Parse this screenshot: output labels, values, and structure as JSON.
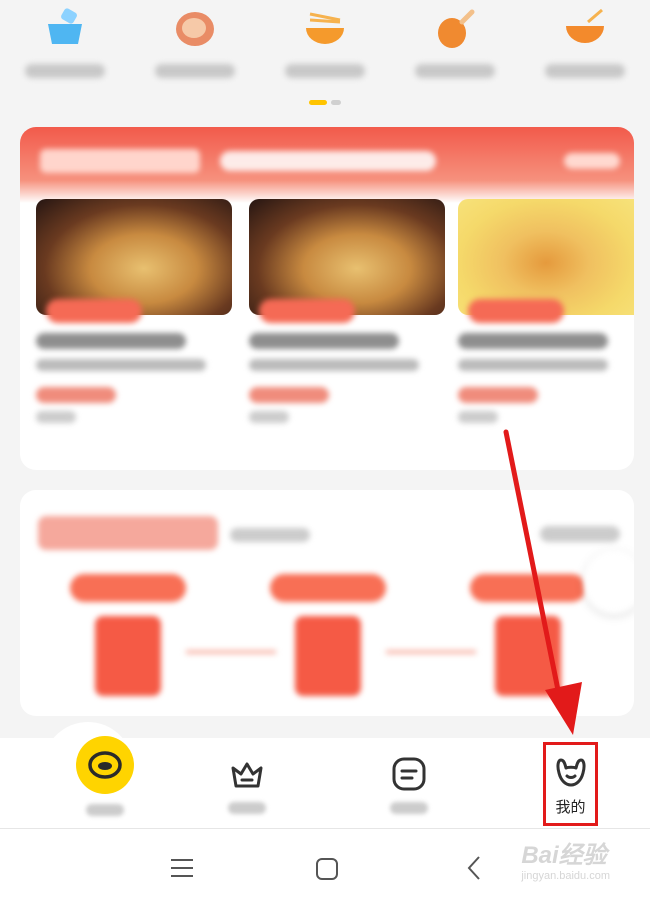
{
  "categories": [
    {
      "icon": "basket-icon",
      "color": "#4fb6f2"
    },
    {
      "icon": "meat-icon",
      "color": "#f2a076"
    },
    {
      "icon": "noodle-bowl-icon",
      "color": "#f59a2c"
    },
    {
      "icon": "drumstick-icon",
      "color": "#f08a30"
    },
    {
      "icon": "soup-bowl-icon",
      "color": "#f38a2c"
    }
  ],
  "pager": {
    "active_color": "#ffc400",
    "inactive_color": "#d0d0d0"
  },
  "promo": {
    "accent": "#f25a4b",
    "product_count": 3
  },
  "newuser_steps": {
    "step_count": 3
  },
  "bottom_nav": {
    "items": [
      {
        "icon": "home-bowl-icon"
      },
      {
        "icon": "crown-icon"
      },
      {
        "icon": "orders-icon"
      },
      {
        "icon": "profile-icon",
        "label": "我的"
      }
    ],
    "home_color": "#ffd400",
    "highlight_color": "#e21a1a"
  },
  "system_nav": {
    "icons": [
      "menu-icon",
      "home-square-icon",
      "back-icon"
    ]
  },
  "watermark": {
    "brand": "Bai经验",
    "url": "jingyan.baidu.com"
  }
}
